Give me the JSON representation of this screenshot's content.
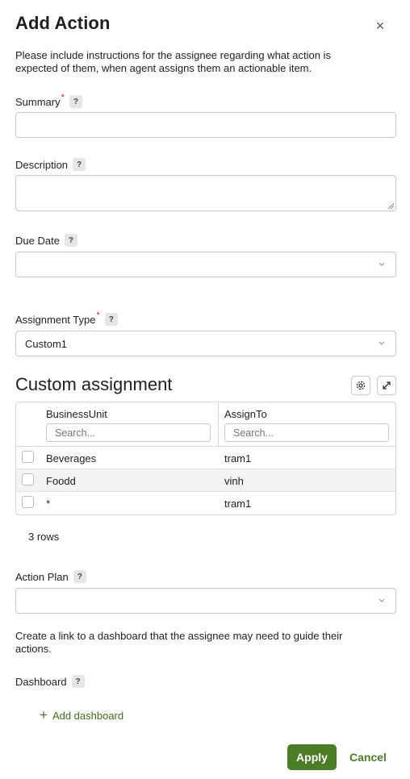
{
  "dialog": {
    "title": "Add Action",
    "close_glyph": "×",
    "intro": "Please include instructions for the assignee regarding what action is expected of them, when agent assigns them an actionable item."
  },
  "help_glyph": "?",
  "required_glyph": "*",
  "fields": {
    "summary": {
      "label": "Summary",
      "value": ""
    },
    "description": {
      "label": "Description",
      "value": ""
    },
    "due_date": {
      "label": "Due Date",
      "value": ""
    },
    "assignment_type": {
      "label": "Assignment Type",
      "value": "Custom1"
    }
  },
  "custom_assignment": {
    "title": "Custom assignment",
    "columns": [
      "BusinessUnit",
      "AssignTo"
    ],
    "search_placeholders": [
      "Search...",
      "Search..."
    ],
    "rows": [
      {
        "business_unit": "Beverages",
        "assign_to": "tram1"
      },
      {
        "business_unit": "Foodd",
        "assign_to": "vinh"
      },
      {
        "business_unit": "*",
        "assign_to": "tram1"
      }
    ],
    "row_count": "3 rows"
  },
  "action_plan": {
    "label": "Action Plan",
    "value": ""
  },
  "dashboard": {
    "intro": "Create a link to a dashboard that the assignee may need to guide their actions.",
    "label": "Dashboard",
    "add_label": "Add dashboard",
    "add_glyph": "+"
  },
  "footer": {
    "apply": "Apply",
    "cancel": "Cancel"
  },
  "colors": {
    "accent": "#4a7d25",
    "link": "#3d6e1c",
    "required": "#d21f1f"
  },
  "icons": [
    "close-icon",
    "help-icon",
    "chevron-down-icon",
    "settings-gear-icon",
    "expand-icon",
    "plus-icon",
    "resize-handle-icon"
  ]
}
